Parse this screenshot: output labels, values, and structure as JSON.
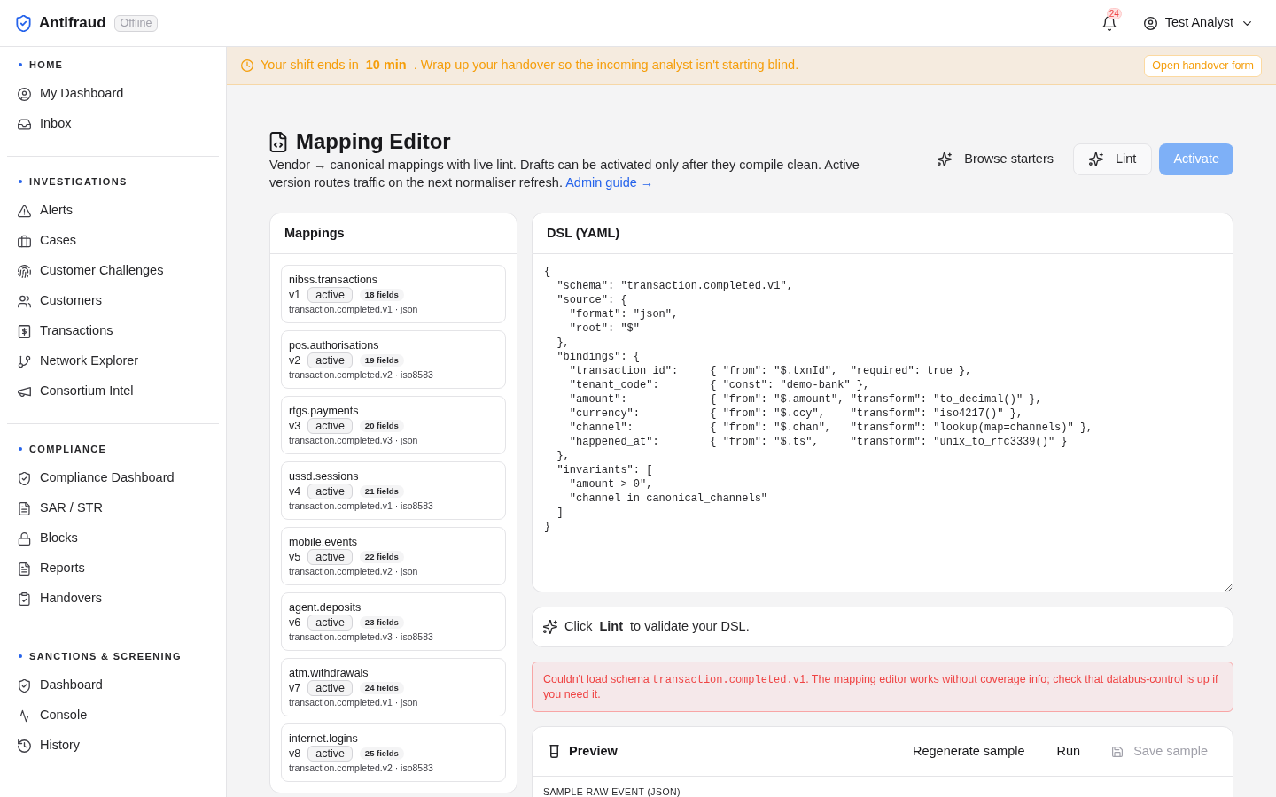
{
  "app": {
    "title": "Antifraud",
    "status": "Offline"
  },
  "notifications": {
    "count": "24"
  },
  "user": {
    "name": "Test Analyst"
  },
  "sidebar": {
    "sections": [
      {
        "title": "HOME",
        "items": [
          {
            "label": "My Dashboard"
          },
          {
            "label": "Inbox"
          }
        ]
      },
      {
        "title": "INVESTIGATIONS",
        "items": [
          {
            "label": "Alerts"
          },
          {
            "label": "Cases"
          },
          {
            "label": "Customer Challenges"
          },
          {
            "label": "Customers"
          },
          {
            "label": "Transactions"
          },
          {
            "label": "Network Explorer"
          },
          {
            "label": "Consortium Intel"
          }
        ]
      },
      {
        "title": "COMPLIANCE",
        "items": [
          {
            "label": "Compliance Dashboard"
          },
          {
            "label": "SAR / STR"
          },
          {
            "label": "Blocks"
          },
          {
            "label": "Reports"
          },
          {
            "label": "Handovers"
          }
        ]
      },
      {
        "title": "SANCTIONS & SCREENING",
        "items": [
          {
            "label": "Dashboard"
          },
          {
            "label": "Console"
          },
          {
            "label": "History"
          }
        ]
      }
    ]
  },
  "banner": {
    "text": "Your shift ends in **10 min** . Wrap up your handover so the incoming analyst isn't starting blind.",
    "action": "Open handover form"
  },
  "page": {
    "title": "Mapping Editor",
    "description": "Vendor → canonical mappings with live lint. Drafts can be activated only after they compile clean. Active version routes traffic on the next normaliser refresh.",
    "link": "Admin guide →",
    "actions": [
      {
        "label": "Browse starters",
        "kind": "ghost",
        "disabled": false
      },
      {
        "label": "Lint",
        "kind": "outline",
        "disabled": false
      },
      {
        "label": "Activate",
        "kind": "primary",
        "disabled": true
      }
    ]
  },
  "mappings": {
    "title": "Mappings",
    "items": [
      {
        "name": "nibss.transactions",
        "version": "v1",
        "status": "active",
        "fields": "18 fields",
        "meta": "transaction.completed.v1 · json"
      },
      {
        "name": "pos.authorisations",
        "version": "v2",
        "status": "active",
        "fields": "19 fields",
        "meta": "transaction.completed.v2 · iso8583"
      },
      {
        "name": "rtgs.payments",
        "version": "v3",
        "status": "active",
        "fields": "20 fields",
        "meta": "transaction.completed.v3 · json"
      },
      {
        "name": "ussd.sessions",
        "version": "v4",
        "status": "active",
        "fields": "21 fields",
        "meta": "transaction.completed.v1 · iso8583"
      },
      {
        "name": "mobile.events",
        "version": "v5",
        "status": "active",
        "fields": "22 fields",
        "meta": "transaction.completed.v2 · json"
      },
      {
        "name": "agent.deposits",
        "version": "v6",
        "status": "active",
        "fields": "23 fields",
        "meta": "transaction.completed.v3 · iso8583"
      },
      {
        "name": "atm.withdrawals",
        "version": "v7",
        "status": "active",
        "fields": "24 fields",
        "meta": "transaction.completed.v1 · json"
      },
      {
        "name": "internet.logins",
        "version": "v8",
        "status": "active",
        "fields": "25 fields",
        "meta": "transaction.completed.v2 · iso8583"
      }
    ]
  },
  "dsl": {
    "title": "DSL (YAML)",
    "code": "{\n  \"schema\": \"transaction.completed.v1\",\n  \"source\": {\n    \"format\": \"json\",\n    \"root\": \"$\"\n  },\n  \"bindings\": {\n    \"transaction_id\":     { \"from\": \"$.txnId\",  \"required\": true },\n    \"tenant_code\":        { \"const\": \"demo-bank\" },\n    \"amount\":             { \"from\": \"$.amount\", \"transform\": \"to_decimal()\" },\n    \"currency\":           { \"from\": \"$.ccy\",    \"transform\": \"iso4217()\" },\n    \"channel\":            { \"from\": \"$.chan\",   \"transform\": \"lookup(map=channels)\" },\n    \"happened_at\":        { \"from\": \"$.ts\",     \"transform\": \"unix_to_rfc3339()\" }\n  },\n  \"invariants\": [\n    \"amount > 0\",\n    \"channel in canonical_channels\"\n  ]\n}"
  },
  "lint_hint": {
    "text": "Click **Lint** to validate your DSL."
  },
  "error": {
    "parts": [
      {
        "kind": "text",
        "text": "Couldn't load schema "
      },
      {
        "kind": "code",
        "text": "transaction.completed.v1"
      },
      {
        "kind": "text",
        "text": ". The mapping editor works without coverage info; check that databus-control is up if you need it."
      }
    ]
  },
  "preview": {
    "title": "Preview",
    "actions": [
      {
        "label": "Regenerate sample",
        "kind": "plain",
        "disabled": false
      },
      {
        "label": "Run",
        "kind": "plain",
        "disabled": false
      },
      {
        "label": "Save sample",
        "kind": "save",
        "disabled": true
      }
    ],
    "section_label": "SAMPLE RAW EVENT (JSON)"
  }
}
